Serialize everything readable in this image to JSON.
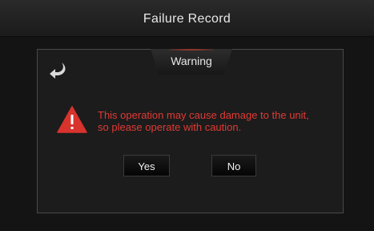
{
  "header": {
    "title": "Failure Record"
  },
  "dialog": {
    "tab_label": "Warning",
    "back_icon": "back-arrow-icon",
    "alert_icon": "warning-triangle-icon",
    "message_line1": "This operation may cause damage to the unit,",
    "message_line2": "so please operate with caution.",
    "yes_label": "Yes",
    "no_label": "No"
  },
  "colors": {
    "background": "#141414",
    "message_text": "#e03a34",
    "alert_icon": "#d8332d",
    "accent_highlight": "#d23c2a"
  }
}
